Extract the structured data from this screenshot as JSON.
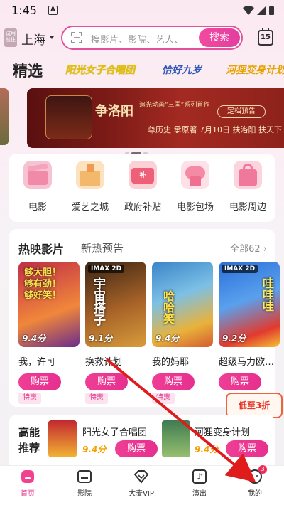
{
  "status_bar": {
    "time": "1:45",
    "notif_glyph": "A"
  },
  "header": {
    "location_badge": "试用 前往",
    "city": "上海",
    "search_placeholder": "搜影片、影院、艺人、",
    "search_button": "搜索",
    "calendar_day": "15"
  },
  "featured": {
    "title": "精选",
    "brands": [
      "阳光女子合唱团",
      "恰好九岁",
      "河狸变身计划"
    ]
  },
  "banner": {
    "logo": "争洛阳",
    "subtitle": "追光动画“三国”系列首作",
    "cta": "定档预告",
    "line2": "尊历史  承原著  7月10日  扶洛阳  扶天下"
  },
  "categories": [
    {
      "label": "电影",
      "icon": "movie-clapper-icon",
      "color": "#f39ab6"
    },
    {
      "label": "爱艺之城",
      "icon": "castle-icon",
      "color": "#f4c98e"
    },
    {
      "label": "政府补贴",
      "icon": "subsidy-ticket-icon",
      "color": "#f07a8d"
    },
    {
      "label": "电影包场",
      "icon": "cloud-popcorn-icon",
      "color": "#f59ab0"
    },
    {
      "label": "电影周边",
      "icon": "shopping-bag-icon",
      "color": "#f28aa8"
    }
  ],
  "movies_section": {
    "tab_active": "热映影片",
    "tab_inactive": "新热预告",
    "all_label": "全部62",
    "buy_label": "购票",
    "deal_label": "特惠",
    "movies": [
      {
        "name": "我，许可",
        "score": "9.4分",
        "tag": "",
        "poster_text": "够大胆！够有劲！够好笑！",
        "colors": [
          "#c12d47",
          "#f0873b"
        ]
      },
      {
        "name": "换救计划",
        "score": "9.1分",
        "tag": "IMAX 2D",
        "poster_text": "宇宙搭子",
        "colors": [
          "#6b3a1d",
          "#c5822f"
        ]
      },
      {
        "name": "我的妈耶",
        "score": "9.4分",
        "tag": "",
        "poster_text": "哈哈笑",
        "colors": [
          "#2f7dc0",
          "#e9b23a"
        ]
      },
      {
        "name": "超级马力欧…",
        "score": "9.2分",
        "tag": "IMAX 2D",
        "poster_text": "哇哇哇",
        "colors": [
          "#2a6fd8",
          "#e23a2d"
        ]
      }
    ]
  },
  "promo": {
    "text": "低至3折"
  },
  "recommend": {
    "title": "高能推荐",
    "buy_label": "购票",
    "items": [
      {
        "name": "阳光女子合唱团",
        "score": "9.4分"
      },
      {
        "name": "河狸变身计划",
        "score": "9.4分"
      }
    ]
  },
  "nav": {
    "items": [
      {
        "label": "首页",
        "icon": "home-icon",
        "active": true
      },
      {
        "label": "影院",
        "icon": "cinema-icon",
        "active": false
      },
      {
        "label": "大麦VIP",
        "icon": "vip-diamond-icon",
        "active": false
      },
      {
        "label": "演出",
        "icon": "music-note-icon",
        "active": false
      },
      {
        "label": "我的",
        "icon": "profile-icon",
        "active": false,
        "badge": "3"
      }
    ]
  }
}
